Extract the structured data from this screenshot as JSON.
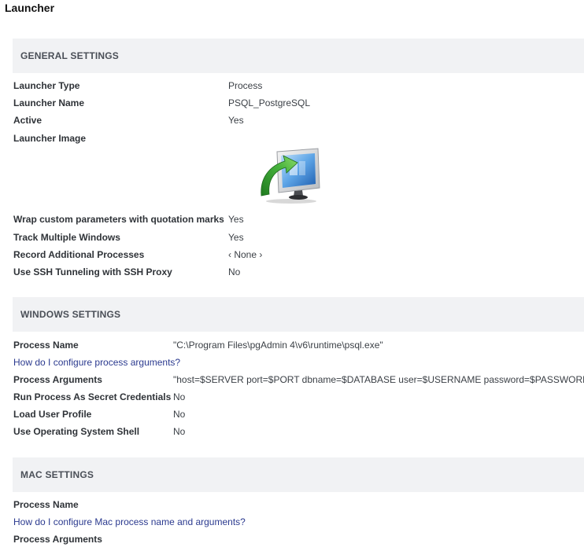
{
  "page": {
    "title": "Launcher"
  },
  "general": {
    "header": "GENERAL SETTINGS",
    "rows": [
      {
        "label": "Launcher Type",
        "value": "Process"
      },
      {
        "label": "Launcher Name",
        "value": "PSQL_PostgreSQL"
      },
      {
        "label": "Active",
        "value": "Yes"
      },
      {
        "label": "Launcher Image",
        "value": ""
      },
      {
        "label": "Wrap custom parameters with quotation marks",
        "value": "Yes"
      },
      {
        "label": "Track Multiple Windows",
        "value": "Yes"
      },
      {
        "label": "Record Additional Processes",
        "value": "‹ None ›"
      },
      {
        "label": "Use SSH Tunneling with SSH Proxy",
        "value": "No"
      }
    ],
    "image_icon": "launcher-process-icon"
  },
  "windows": {
    "header": "WINDOWS SETTINGS",
    "process_name_label": "Process Name",
    "process_name_value": "\"C:\\Program Files\\pgAdmin 4\\v6\\runtime\\psql.exe\"",
    "help_link": "How do I configure process arguments?",
    "rows": [
      {
        "label": "Process Arguments",
        "value": "\"host=$SERVER port=$PORT dbname=$DATABASE user=$USERNAME password=$PASSWORD\""
      },
      {
        "label": "Run Process As Secret Credentials",
        "value": "No"
      },
      {
        "label": "Load User Profile",
        "value": "No"
      },
      {
        "label": "Use Operating System Shell",
        "value": "No"
      }
    ]
  },
  "mac": {
    "header": "MAC SETTINGS",
    "process_name_label": "Process Name",
    "help_link": "How do I configure Mac process name and arguments?",
    "process_arguments_label": "Process Arguments"
  },
  "colors": {
    "header_bg": "#f1f2f4",
    "link": "#2b3a8f",
    "arrow_green": "#3aa535",
    "monitor_blue": "#3b7fd0"
  }
}
